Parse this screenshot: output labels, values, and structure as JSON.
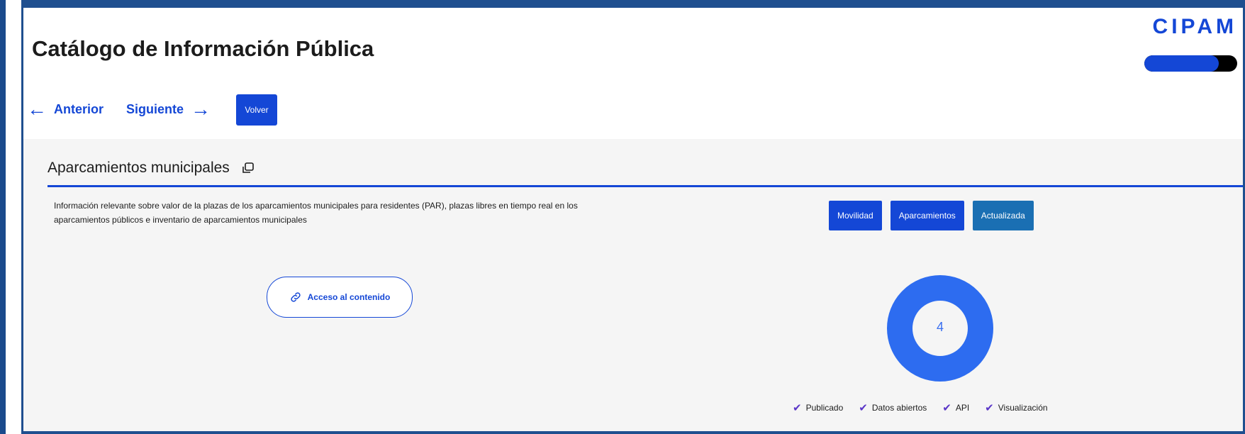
{
  "page": {
    "title": "Catálogo de Información Pública"
  },
  "brand": {
    "name": "CIPAM",
    "progress": 0.8,
    "colors": {
      "primary": "#1447d6",
      "track": "#000000"
    }
  },
  "nav": {
    "prev_label": "Anterior",
    "next_label": "Siguiente",
    "back_label": "Volver",
    "prev_icon": "arrow-left-icon",
    "next_icon": "arrow-right-icon"
  },
  "dataset": {
    "title": "Aparcamientos municipales",
    "copy_icon": "copy-icon",
    "description": "Información relevante sobre valor de la plazas de los aparcamientos municipales para residentes (PAR), plazas libres en tiempo real en los aparcamientos públicos e inventario de aparcamientos municipales",
    "tags": [
      {
        "label": "Movilidad",
        "color": "#1447d6"
      },
      {
        "label": "Aparcamientos",
        "color": "#1447d6"
      },
      {
        "label": "Actualizada",
        "color": "#1a6fb3"
      }
    ],
    "access_label": "Acceso al contenido",
    "access_icon": "link-icon",
    "score": "4",
    "score_color": "#3a6ff0",
    "checks": [
      {
        "label": "Publicado",
        "icon": "checkmark-icon"
      },
      {
        "label": "Datos abiertos",
        "icon": "checkmark-icon"
      },
      {
        "label": "API",
        "icon": "checkmark-icon"
      },
      {
        "label": "Visualización",
        "icon": "checkmark-icon"
      }
    ]
  }
}
